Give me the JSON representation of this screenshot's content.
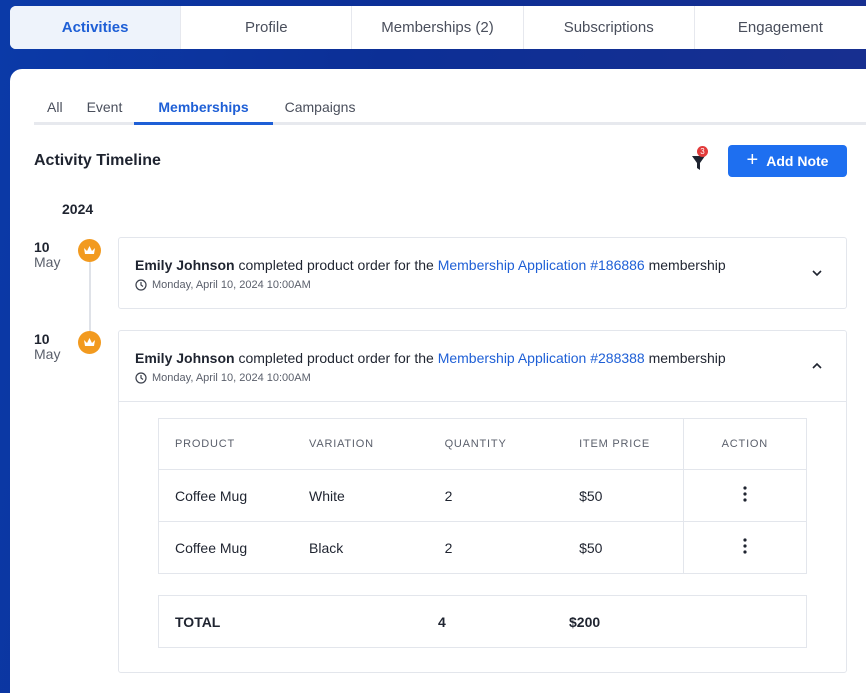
{
  "top_tabs": [
    {
      "label": "Activities",
      "active": true
    },
    {
      "label": "Profile",
      "active": false
    },
    {
      "label": "Memberships (2)",
      "active": false
    },
    {
      "label": "Subscriptions",
      "active": false
    },
    {
      "label": "Engagement",
      "active": false
    }
  ],
  "sub_tabs": [
    {
      "label": "All",
      "active": false
    },
    {
      "label": "Event",
      "active": false
    },
    {
      "label": "Memberships",
      "active": true
    },
    {
      "label": "Campaigns",
      "active": false
    }
  ],
  "timeline": {
    "title": "Activity Timeline",
    "filter_count": "3",
    "add_note_label": "Add Note",
    "year": "2024"
  },
  "activities": [
    {
      "day": "10",
      "month": "May",
      "user": "Emily Johnson",
      "action_text": " completed product order for the ",
      "link_text": "Membership Application #186886",
      "suffix": " membership",
      "timestamp": "Monday, April 10, 2024 10:00AM",
      "expanded": false
    },
    {
      "day": "10",
      "month": "May",
      "user": "Emily Johnson",
      "action_text": " completed product order for the ",
      "link_text": "Membership Application #288388",
      "suffix": " membership",
      "timestamp": "Monday, April 10, 2024 10:00AM",
      "expanded": true
    }
  ],
  "order_table": {
    "headers": [
      "PRODUCT",
      "VARIATION",
      "QUANTITY",
      "ITEM PRICE",
      "ACTION"
    ],
    "rows": [
      {
        "product": "Coffee Mug",
        "variation": "White",
        "quantity": "2",
        "price": "$50"
      },
      {
        "product": "Coffee Mug",
        "variation": "Black",
        "quantity": "2",
        "price": "$50"
      }
    ],
    "total": {
      "label": "TOTAL",
      "quantity": "4",
      "price": "$200"
    }
  },
  "colors": {
    "accent": "#1e5fd6",
    "button": "#1e6ff0",
    "timeline_dot": "#f29a1f",
    "badge": "#e23b3b",
    "background": "#0c2f96"
  },
  "icons": {
    "timeline_dot": "crown-icon",
    "filter": "filter-icon",
    "timestamp": "clock-icon",
    "expand": "chevron-down-icon",
    "collapse": "chevron-up-icon",
    "row_action": "more-vertical-icon",
    "add": "plus-icon"
  }
}
